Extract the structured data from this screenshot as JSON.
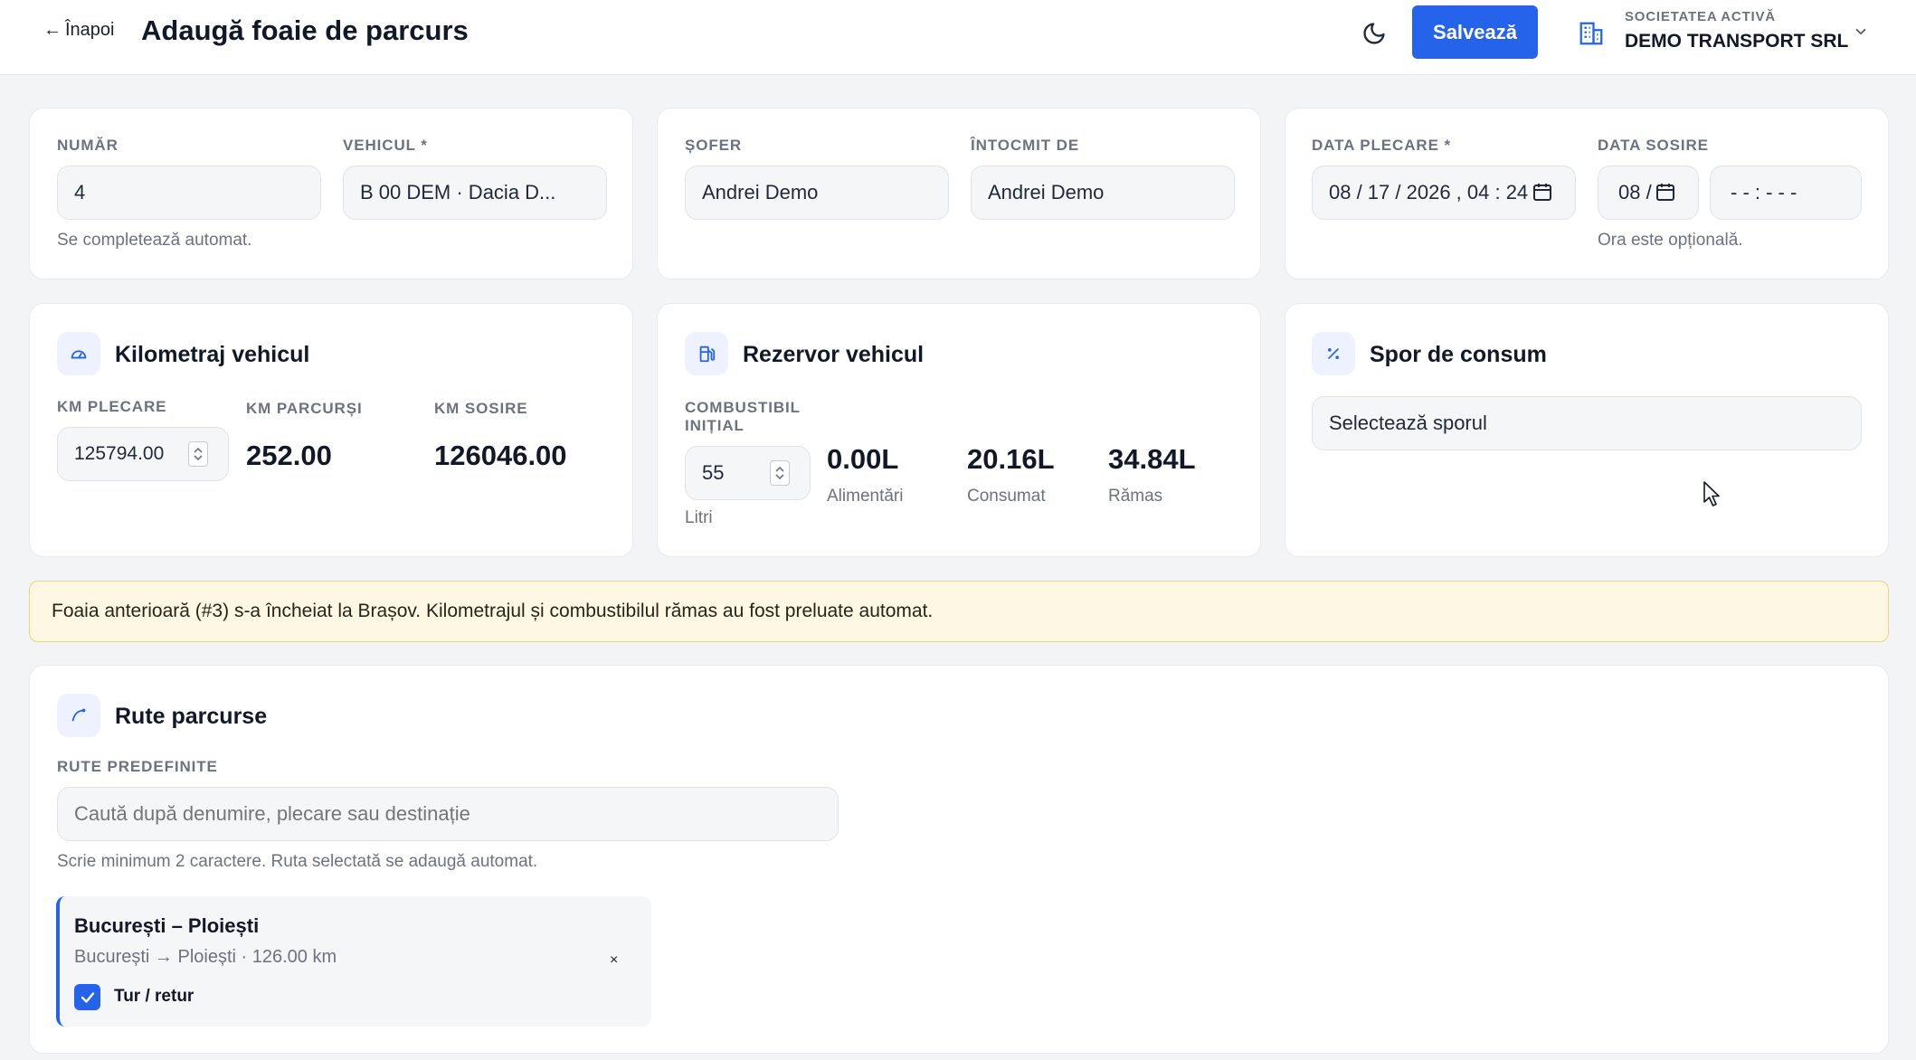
{
  "header": {
    "back_label": "Înapoi",
    "title": "Adaugă foaie de parcurs",
    "save_label": "Salvează",
    "company_label": "SOCIETATEA ACTIVĂ",
    "company_name": "DEMO TRANSPORT SRL"
  },
  "general": {
    "number_label": "NUMĂR",
    "number_value": "4",
    "number_hint": "Se completează automat.",
    "vehicle_label": "VEHICUL *",
    "vehicle_value": "B 00 DEM · Dacia D...",
    "driver_label": "ȘOFER",
    "driver_value": "Andrei Demo",
    "author_label": "ÎNTOCMIT DE",
    "author_value": "Andrei Demo",
    "departure_label": "DATA PLECARE *",
    "departure_value": "08 / 17 / 2026 ,  04 : 24",
    "arrival_label": "DATA SOSIRE",
    "arrival_date_value": "08 /",
    "arrival_time_value": "- - : - -   -",
    "arrival_hint": "Ora este opțională."
  },
  "odometer": {
    "title": "Kilometraj vehicul",
    "start_label": "KM PLECARE",
    "start_value": "125794.00",
    "driven_label": "KM PARCURȘI",
    "driven_value": "252.00",
    "end_label": "KM SOSIRE",
    "end_value": "126046.00"
  },
  "tank": {
    "title": "Rezervor vehicul",
    "initial_label_line1": "COMBUSTIBIL",
    "initial_label_line2": "INIȚIAL",
    "initial_value": "55",
    "initial_unit": "Litri",
    "refuel_value": "0.00L",
    "refuel_label": "Alimentări",
    "consumed_value": "20.16L",
    "consumed_label": "Consumat",
    "remaining_value": "34.84L",
    "remaining_label": "Rămas"
  },
  "consumption": {
    "title": "Spor de consum",
    "select_value": "Selectează sporul"
  },
  "banner": {
    "text": "Foaia anterioară (#3) s-a încheiat la Brașov. Kilometrajul și combustibilul rămas au fost preluate automat."
  },
  "routes": {
    "title": "Rute parcurse",
    "predefined_label": "RUTE PREDEFINITE",
    "search_placeholder": "Caută după denumire, plecare sau destinație",
    "search_hint": "Scrie minimum 2 caractere. Ruta selectată se adaugă automat.",
    "items": [
      {
        "name": "București – Ploiești",
        "detail": "București → Ploiești · 126.00 km",
        "remove": "×",
        "round_trip_label": "Tur / retur"
      }
    ]
  },
  "colors": {
    "accent": "#2563eb",
    "banner_bg": "#fdf7e3",
    "banner_border": "#ecd47c"
  }
}
